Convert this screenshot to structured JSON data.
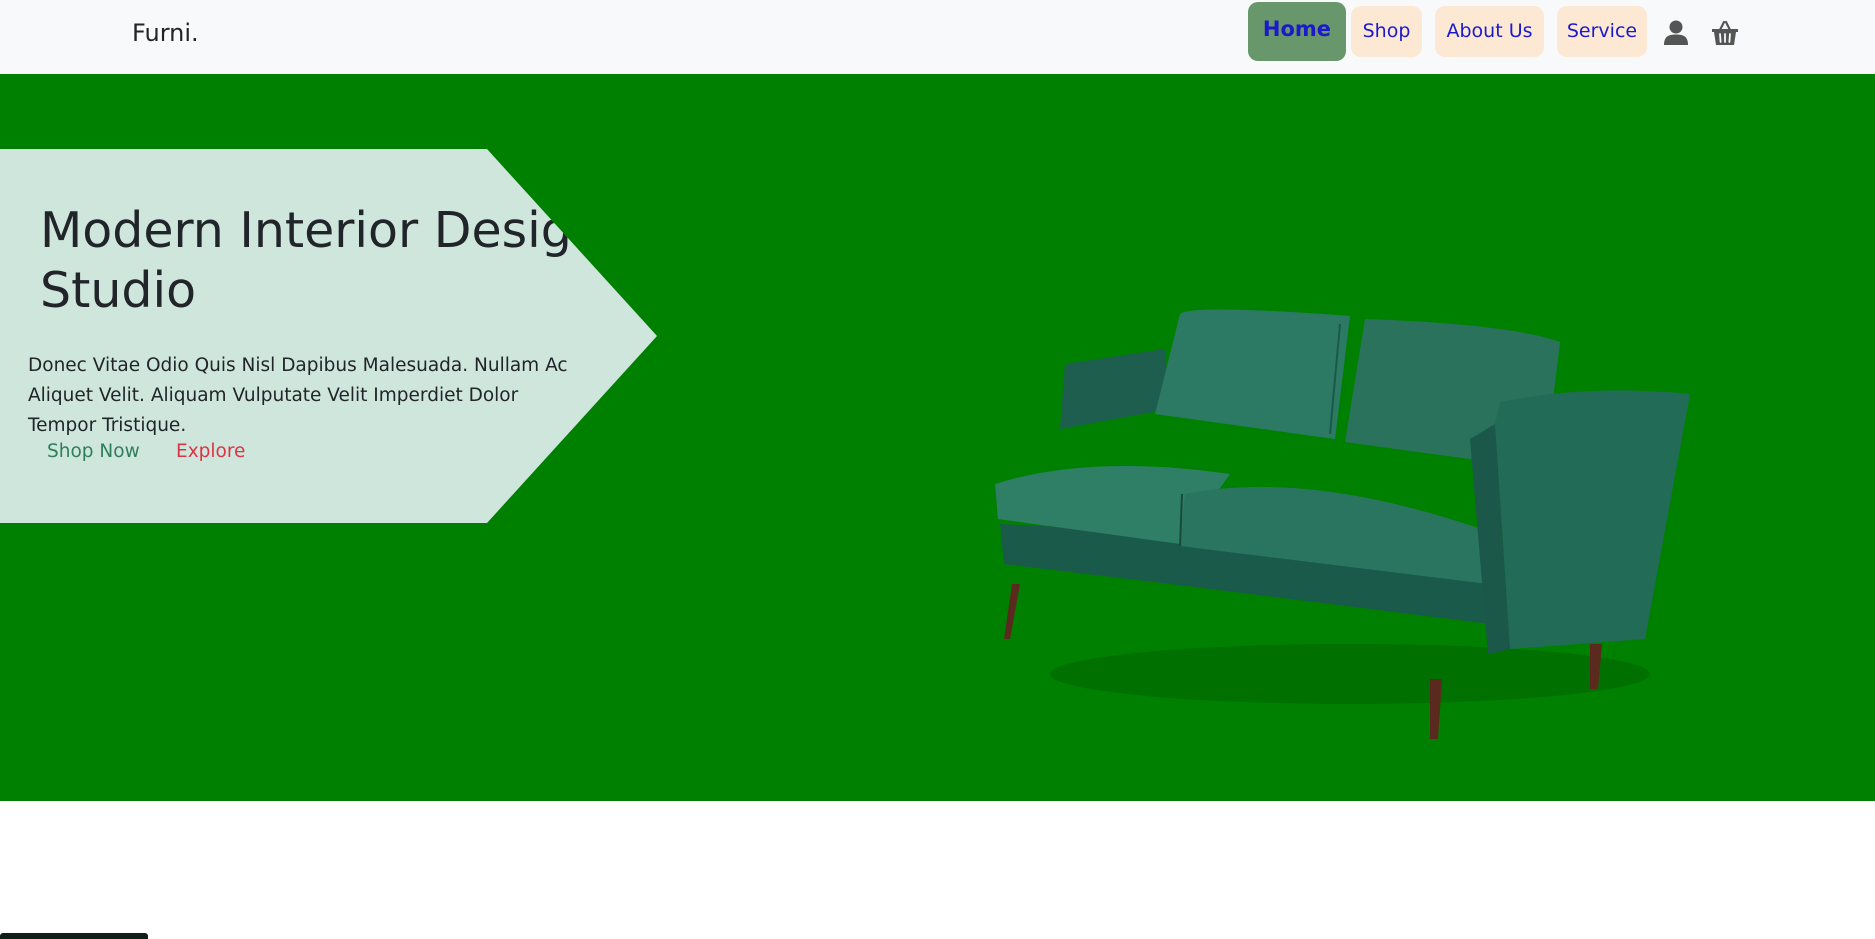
{
  "navbar": {
    "brand": "Furni.",
    "items": [
      {
        "label": "Home",
        "active": true
      },
      {
        "label": "Shop",
        "active": false
      },
      {
        "label": "About Us",
        "active": false
      },
      {
        "label": "Service",
        "active": false
      }
    ],
    "icons": [
      "user-icon",
      "cart-icon"
    ]
  },
  "hero": {
    "title_line1": "Modern Interior Design",
    "title_line2": "Studio",
    "text": "Donec Vitae Odio Quis Nisl Dapibus Malesuada. Nullam Ac Aliquet Velit. Aliquam Vulputate Velit Imperdiet Dolor Tempor Tristique.",
    "buttons": {
      "primary": "Shop Now",
      "secondary": "Explore"
    },
    "image": "green-velvet-sofa"
  },
  "colors": {
    "navbar_bg": "#f8f9fa",
    "hero_bg": "#008000",
    "banner_bg": "#cfe6dc",
    "nav_item_bg": "#fde8d4",
    "nav_active_bg": "#67976a",
    "nav_text": "#1a1acb",
    "shop_now": "#2e7d5b",
    "explore": "#dc3545"
  }
}
